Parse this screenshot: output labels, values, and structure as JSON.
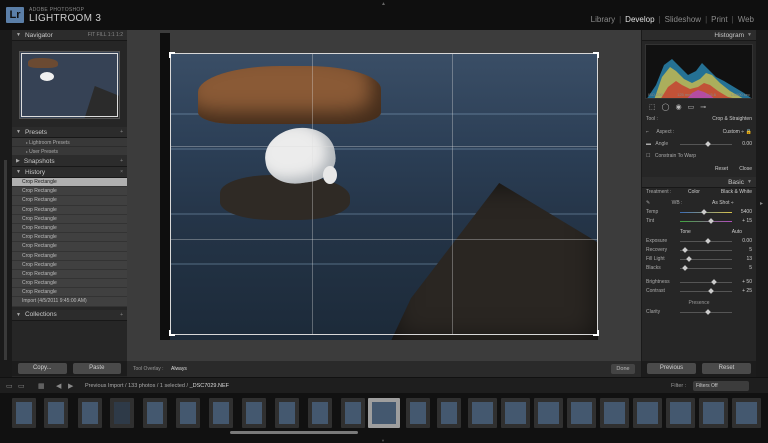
{
  "app": {
    "logo": "Lr",
    "brand_sub": "ADOBE PHOTOSHOP",
    "brand_main": "LIGHTROOM 3"
  },
  "modules": [
    {
      "label": "Library",
      "active": false
    },
    {
      "label": "Develop",
      "active": true
    },
    {
      "label": "Slideshow",
      "active": false
    },
    {
      "label": "Print",
      "active": false
    },
    {
      "label": "Web",
      "active": false
    }
  ],
  "left_panel": {
    "navigator": {
      "title": "Navigator",
      "zoom_options": "FIT   FILL   1:1   1:2"
    },
    "presets": {
      "title": "Presets",
      "items": [
        "Lightroom Presets",
        "User Presets"
      ]
    },
    "snapshots": {
      "title": "Snapshots"
    },
    "history": {
      "title": "History",
      "items": [
        "Crop Rectangle",
        "Crop Rectangle",
        "Crop Rectangle",
        "Crop Rectangle",
        "Crop Rectangle",
        "Crop Rectangle",
        "Crop Rectangle",
        "Crop Rectangle",
        "Crop Rectangle",
        "Crop Rectangle",
        "Crop Rectangle",
        "Crop Rectangle",
        "Crop Rectangle",
        "Import (4/5/2011 9:45:00 AM)"
      ],
      "selected_index": 0
    },
    "collections": {
      "title": "Collections"
    },
    "copy_label": "Copy...",
    "paste_label": "Paste"
  },
  "toolbar": {
    "overlay_label": "Tool Overlay :",
    "overlay_value": "Always",
    "done_label": "Done"
  },
  "right_panel": {
    "histogram_title": "Histogram",
    "histogram_readout": [
      "ISO 200",
      "125 mm",
      "f / 5.6",
      "1/1600 sec"
    ],
    "crop": {
      "tool_label": "Tool :",
      "tool_value": "Crop & Straighten",
      "aspect_label": "Aspect :",
      "aspect_value": "Custom ÷",
      "angle_label": "Angle",
      "angle_value": "0.00",
      "constrain_label": "Constrain To Warp",
      "reset_label": "Reset",
      "close_label": "Close"
    },
    "basic": {
      "title": "Basic",
      "treatment_label": "Treatment :",
      "treatment_color": "Color",
      "treatment_bw": "Black & White",
      "wb_label": "WB :",
      "wb_value": "As Shot ÷",
      "temp_label": "Temp",
      "temp_value": "5400",
      "tint_label": "Tint",
      "tint_value": "+ 15",
      "tone_label": "Tone",
      "auto_label": "Auto",
      "exposure_label": "Exposure",
      "exposure_value": "0.00",
      "recovery_label": "Recovery",
      "recovery_value": "5",
      "filllight_label": "Fill Light",
      "filllight_value": "13",
      "blacks_label": "Blacks",
      "blacks_value": "5",
      "brightness_label": "Brightness",
      "brightness_value": "+ 50",
      "contrast_label": "Contrast",
      "contrast_value": "+ 25",
      "presence_label": "Presence",
      "clarity_label": "Clarity"
    },
    "previous_label": "Previous",
    "reset_label": "Reset"
  },
  "filmstrip": {
    "info_prefix": "Previous Import / 133 photos / 1 selected /",
    "filename": "_DSC7029.NEF",
    "filter_label": "Filter :",
    "filter_value": "Filters Off",
    "selected_index": 11
  },
  "colors": {
    "accent_logo": "#5b7fa8",
    "panel_bg": "#262626",
    "selected_row": "#b0b0b0"
  }
}
